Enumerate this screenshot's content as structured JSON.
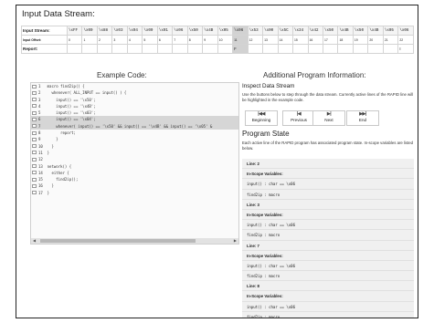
{
  "header": {
    "title": "Input Data Stream:"
  },
  "stream": {
    "row_labels": [
      "Input Stream:",
      "Input Offset:",
      "Report:"
    ],
    "cells": [
      "\\xFF",
      "\\x00",
      "\\x88",
      "\\x03",
      "\\x04",
      "\\x00",
      "\\x01",
      "\\x06",
      "\\x50",
      "\\x4B",
      "\\x05",
      "\\x06",
      "\\x53",
      "\\x00",
      "\\x5C",
      "\\x34",
      "\\x42",
      "\\x50",
      "\\x4B",
      "\\x50",
      "\\x4B",
      "\\x05",
      "\\x06"
    ],
    "offsets": [
      "0",
      "1",
      "2",
      "3",
      "4",
      "5",
      "6",
      "7",
      "8",
      "9",
      "10",
      "11",
      "12",
      "13",
      "14",
      "15",
      "16",
      "17",
      "18",
      "19",
      "20",
      "21",
      "22"
    ],
    "active_index": 11,
    "reports": [
      {
        "col": 11,
        "text": "F"
      },
      {
        "col": 22,
        "text": "I"
      }
    ]
  },
  "code_panel": {
    "heading": "Example Code:",
    "highlighted_lines": [
      5,
      6
    ],
    "lines": [
      "1   macro find2ip() {",
      "2     whenever( ALL_INPUT == input() ) {",
      "3       input() == '\\x50';",
      "4       input() == '\\x4B';",
      "5       input() == '\\x03';",
      "6       input() == '\\x04';",
      "7       whenever( input() == '\\x50' && input() == '\\x4B' && input() == '\\x05' &",
      "8         report;",
      "9       }",
      "10    }",
      "11  }",
      "12",
      "13  network() {",
      "14    either {",
      "15      find2ip();",
      "16    }",
      "17  }"
    ]
  },
  "info_panel": {
    "heading": "Additional Program Information:",
    "inspect_heading": "Inspect Data Stream",
    "inspect_note": "Use the buttons below to step through the data stream. Currently active lines of the RAPID line will be highlighted in the example code.",
    "buttons": [
      {
        "glyph": "|◀◀",
        "label": "Beginning",
        "icon": "skip-to-start-icon"
      },
      {
        "glyph": "|◀",
        "label": "Previous",
        "icon": "step-back-icon"
      },
      {
        "glyph": "▶|",
        "label": "Next",
        "icon": "step-forward-icon"
      },
      {
        "glyph": "▶▶|",
        "label": "End",
        "icon": "skip-to-end-icon"
      }
    ],
    "state_heading": "Program State",
    "state_note": "Each active line of the RAPID program has associated program state. In-scope variables are listed below.",
    "state_rows": [
      {
        "kind": "b",
        "text": "Line: 2"
      },
      {
        "kind": "b",
        "text": "In-Scope Variables:"
      },
      {
        "kind": "m",
        "text": "input() : char == \\x06"
      },
      {
        "kind": "m",
        "text": "find2ip : macro"
      },
      {
        "kind": "b",
        "text": "Line: 3"
      },
      {
        "kind": "b",
        "text": "In-Scope Variables:"
      },
      {
        "kind": "m",
        "text": "input() : char == \\x06"
      },
      {
        "kind": "m",
        "text": "find2ip : macro"
      },
      {
        "kind": "b",
        "text": "Line: 7"
      },
      {
        "kind": "b",
        "text": "In-Scope Variables:"
      },
      {
        "kind": "m",
        "text": "input() : char == \\x06"
      },
      {
        "kind": "m",
        "text": "find2ip : macro"
      },
      {
        "kind": "b",
        "text": "Line: 8"
      },
      {
        "kind": "b",
        "text": "In-Scope Variables:"
      },
      {
        "kind": "m",
        "text": "input() : char == \\x06"
      },
      {
        "kind": "m",
        "text": "find2ip : macro"
      }
    ]
  }
}
